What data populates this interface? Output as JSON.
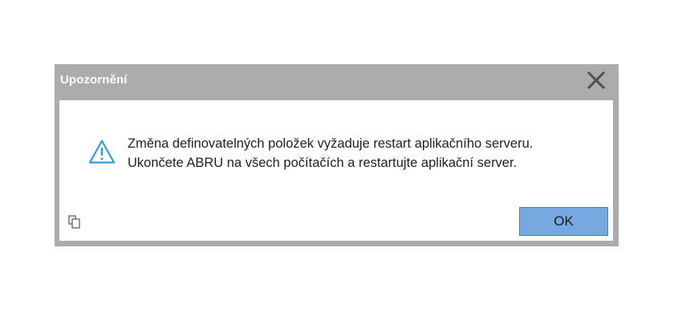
{
  "dialog": {
    "title": "Upozornění",
    "close_icon": "close-icon",
    "message_lines": [
      "Změna definovatelných položek vyžaduje restart aplikačního serveru.",
      "Ukončete ABRU na všech počítačích a restartujte aplikační server."
    ],
    "warning_icon": "warning-triangle-icon",
    "copy_icon": "copy-icon",
    "ok_label": "OK",
    "colors": {
      "frame": "#acacac",
      "accent_icon": "#2f9ad6",
      "ok_button": "#78a8e0"
    }
  }
}
